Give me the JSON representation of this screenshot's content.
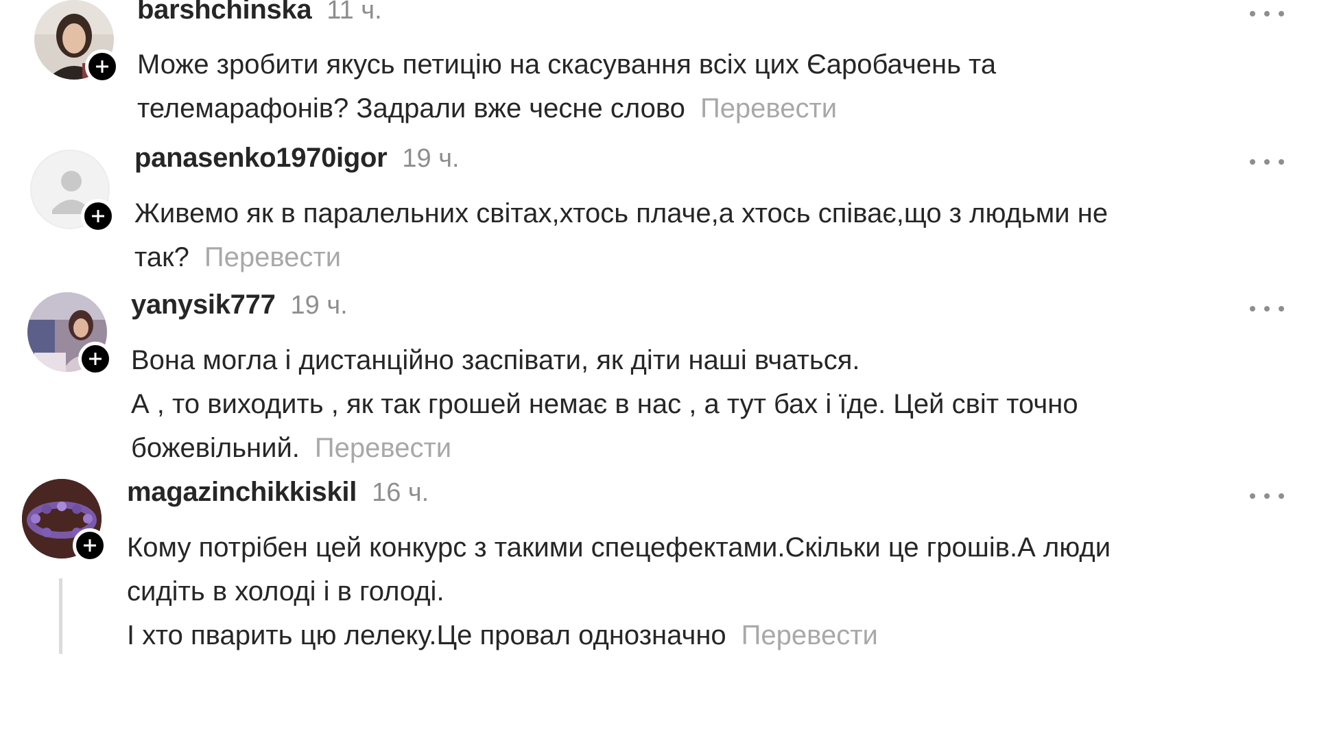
{
  "comments": [
    {
      "username": "barshchinska",
      "time": "11 ч.",
      "lines": [
        "Може зробити якусь петицію на скасування всіх цих Єаробачень та",
        "телемарафонів? Задрали вже чесне слово"
      ],
      "translate": "Перевести"
    },
    {
      "username": "panasenko1970igor",
      "time": "19 ч.",
      "lines": [
        "Живемо як в паралельних світах,хтось плаче,а хтось співає,що з людьми не",
        "так?"
      ],
      "translate": "Перевести"
    },
    {
      "username": "yanysik777",
      "time": "19 ч.",
      "lines": [
        "Вона могла і дистанційно заспівати, як діти наші вчаться.",
        "А , то виходить , як так грошей немає в нас , а тут бах і їде. Цей світ точно",
        "божевільний."
      ],
      "translate": "Перевести"
    },
    {
      "username": "magazinchikkiskil",
      "time": "16 ч.",
      "lines": [
        "Кому потрібен цей конкурс з такими спецефектами.Скільки це грошів.А люди",
        "сидіть в холоді і в голоді.",
        "І хто пварить цю лелеку.Це провал однозначно"
      ],
      "translate": "Перевести"
    }
  ],
  "colors": {
    "text": "#262626",
    "muted": "#8e8e8e",
    "translate": "#a8a8a8",
    "badge": "#000000",
    "thread_line": "#dbdbdb"
  },
  "icons": {
    "more": "more-options-icon",
    "follow": "plus-icon",
    "default_avatar": "default-user-icon"
  }
}
